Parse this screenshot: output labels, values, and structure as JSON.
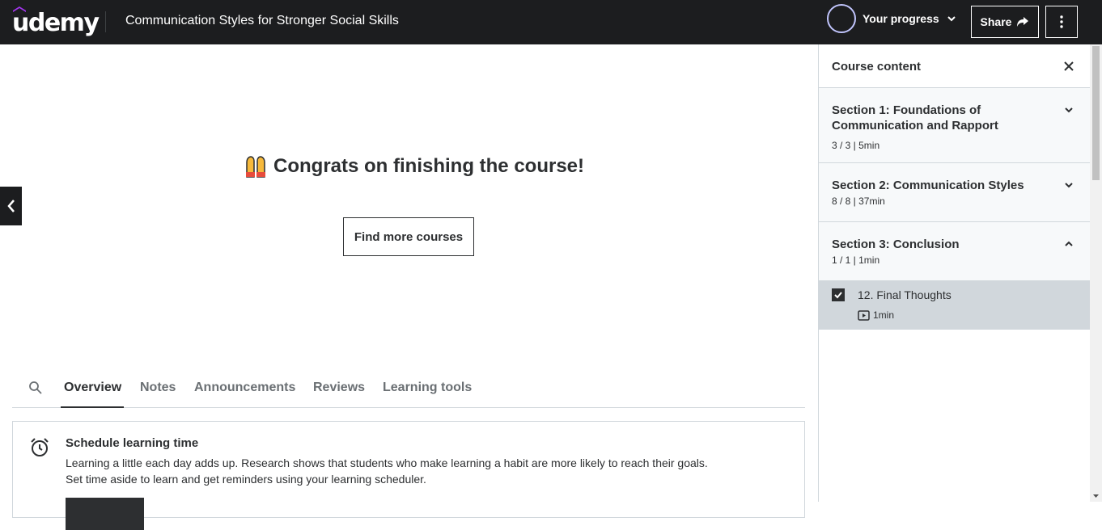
{
  "header": {
    "logo": "udemy",
    "course_title": "Communication Styles for Stronger Social Skills",
    "progress_label": "Your progress",
    "share_label": "Share"
  },
  "main": {
    "congrats_text": "Congrats on finishing the course!",
    "find_courses_label": "Find more courses",
    "tabs": [
      {
        "label": "Overview",
        "active": true
      },
      {
        "label": "Notes",
        "active": false
      },
      {
        "label": "Announcements",
        "active": false
      },
      {
        "label": "Reviews",
        "active": false
      },
      {
        "label": "Learning tools",
        "active": false
      }
    ],
    "schedule": {
      "title": "Schedule learning time",
      "line1": "Learning a little each day adds up. Research shows that students who make learning a habit are more likely to reach their goals.",
      "line2": "Set time aside to learn and get reminders using your learning scheduler."
    }
  },
  "sidebar": {
    "title": "Course content",
    "sections": [
      {
        "title": "Section 1: Foundations of Communication and Rapport",
        "meta": "3 / 3 | 5min",
        "expanded": false
      },
      {
        "title": "Section 2: Communication Styles",
        "meta": "8 / 8 | 37min",
        "expanded": false
      },
      {
        "title": "Section 3: Conclusion",
        "meta": "1 / 1 | 1min",
        "expanded": true
      }
    ],
    "lecture": {
      "title": "12. Final Thoughts",
      "duration": "1min",
      "completed": true
    }
  },
  "colors": {
    "header_bg": "#1c1d1f",
    "progress_ring": "#c0c4fc",
    "brand_purple": "#a435f0",
    "active_lecture_bg": "#d1d7dc",
    "section_bg": "#f7f9fa"
  }
}
